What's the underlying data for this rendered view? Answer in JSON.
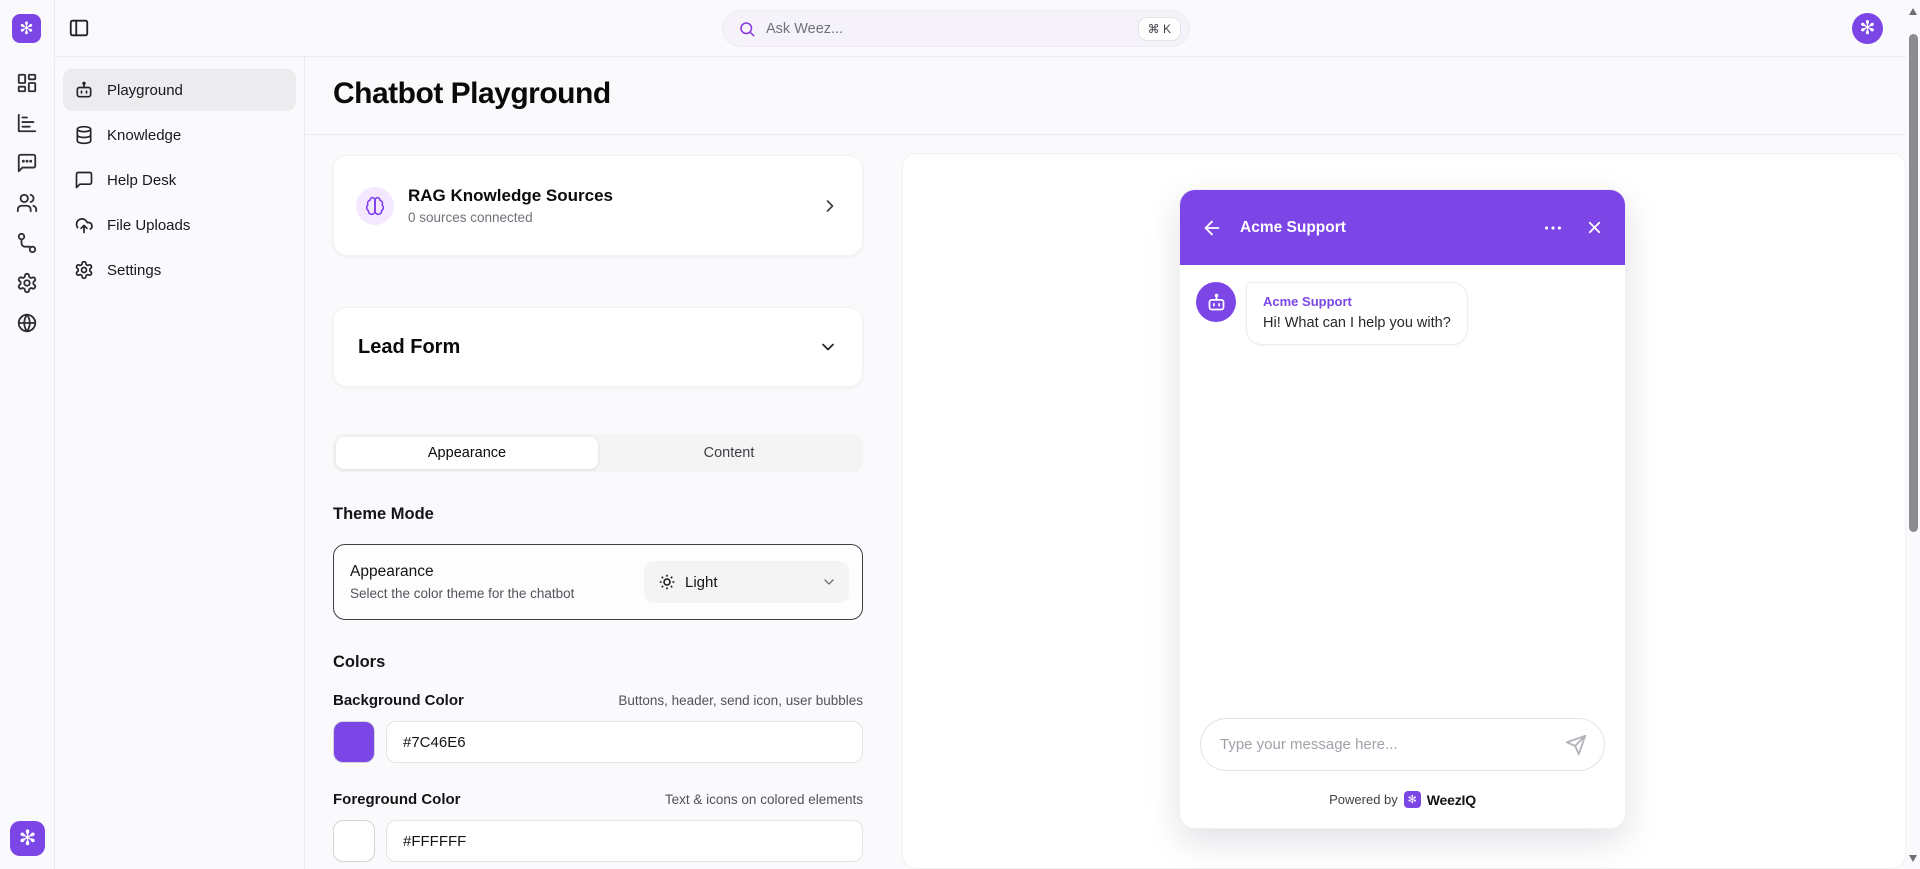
{
  "colors": {
    "accent": "#7C46E6",
    "accent_light_bg": "#F3E8FF",
    "page_bg": "#FAF9FB"
  },
  "icons": {
    "logo_glyph": "✻"
  },
  "topbar": {
    "search": {
      "placeholder": "Ask Weez...",
      "shortcut": "⌘ K"
    }
  },
  "rail": {
    "icons": [
      "dashboard",
      "analytics",
      "conversations",
      "users",
      "workflow",
      "settings",
      "globe"
    ]
  },
  "sidebar": {
    "items": [
      {
        "label": "Playground",
        "icon": "bot",
        "active": true
      },
      {
        "label": "Knowledge",
        "icon": "database",
        "active": false
      },
      {
        "label": "Help Desk",
        "icon": "message-square",
        "active": false
      },
      {
        "label": "File Uploads",
        "icon": "cloud-upload",
        "active": false
      },
      {
        "label": "Settings",
        "icon": "gear",
        "active": false
      }
    ]
  },
  "page": {
    "title": "Chatbot Playground"
  },
  "rag_card": {
    "title": "RAG Knowledge Sources",
    "subtitle": "0 sources connected"
  },
  "lead_form": {
    "title": "Lead Form"
  },
  "tabs": [
    {
      "label": "Appearance",
      "active": true
    },
    {
      "label": "Content",
      "active": false
    }
  ],
  "theme": {
    "heading": "Theme Mode",
    "card_title": "Appearance",
    "card_desc": "Select the color theme for the chatbot",
    "select_value": "Light"
  },
  "colors_section": {
    "heading": "Colors",
    "fields": [
      {
        "label": "Background Color",
        "desc": "Buttons, header, send icon, user bubbles",
        "value": "#7C46E6",
        "swatch": "#7C46E6"
      },
      {
        "label": "Foreground Color",
        "desc": "Text & icons on colored elements",
        "value": "#FFFFFF",
        "swatch": "#FFFFFF"
      }
    ]
  },
  "chat": {
    "title": "Acme Support",
    "message": {
      "sender": "Acme Support",
      "text": "Hi! What can I help you with?"
    },
    "input_placeholder": "Type your message here...",
    "powered_by": "Powered by",
    "brand": "WeezIQ"
  }
}
